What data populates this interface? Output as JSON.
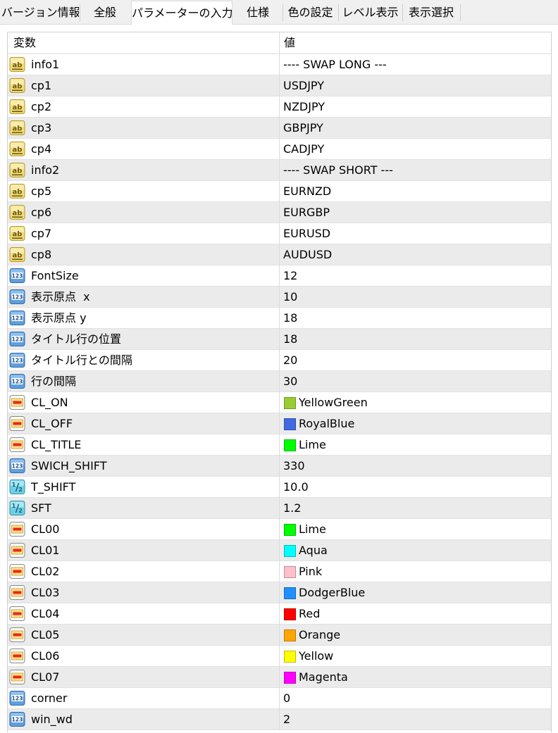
{
  "tabs": [
    "バージョン情報",
    "全般",
    "パラメーターの入力",
    "仕様",
    "色の設定",
    "レベル表示",
    "表示選択"
  ],
  "active_tab": "パラメーターの入力",
  "grid": {
    "col_variable": "変数",
    "col_value": "値",
    "rows": [
      {
        "icon": "string-type-icon",
        "name": "info1",
        "value": "---- SWAP LONG ---"
      },
      {
        "icon": "string-type-icon",
        "name": "cp1",
        "value": "USDJPY"
      },
      {
        "icon": "string-type-icon",
        "name": "cp2",
        "value": "NZDJPY"
      },
      {
        "icon": "string-type-icon",
        "name": "cp3",
        "value": "GBPJPY"
      },
      {
        "icon": "string-type-icon",
        "name": "cp4",
        "value": "CADJPY"
      },
      {
        "icon": "string-type-icon",
        "name": "info2",
        "value": "---- SWAP SHORT ---"
      },
      {
        "icon": "string-type-icon",
        "name": "cp5",
        "value": "EURNZD"
      },
      {
        "icon": "string-type-icon",
        "name": "cp6",
        "value": "EURGBP"
      },
      {
        "icon": "string-type-icon",
        "name": "cp7",
        "value": "EURUSD"
      },
      {
        "icon": "string-type-icon",
        "name": "cp8",
        "value": "AUDUSD"
      },
      {
        "icon": "integer-type-icon",
        "name": "FontSize",
        "value": "12"
      },
      {
        "icon": "integer-type-icon",
        "name": "表示原点  x",
        "value": "10"
      },
      {
        "icon": "integer-type-icon",
        "name": "表示原点 y",
        "value": "18"
      },
      {
        "icon": "integer-type-icon",
        "name": "タイトル行の位置",
        "value": "18"
      },
      {
        "icon": "integer-type-icon",
        "name": "タイトル行との間隔",
        "value": "20"
      },
      {
        "icon": "integer-type-icon",
        "name": "行の間隔",
        "value": "30"
      },
      {
        "icon": "color-type-icon",
        "name": "CL_ON",
        "value": "YellowGreen",
        "swatch": "#9acd32"
      },
      {
        "icon": "color-type-icon",
        "name": "CL_OFF",
        "value": "RoyalBlue",
        "swatch": "#4169e1"
      },
      {
        "icon": "color-type-icon",
        "name": "CL_TITLE",
        "value": "Lime",
        "swatch": "#00ff00"
      },
      {
        "icon": "integer-type-icon",
        "name": "SWICH_SHIFT",
        "value": "330"
      },
      {
        "icon": "double-type-icon",
        "name": "T_SHIFT",
        "value": "10.0"
      },
      {
        "icon": "double-type-icon",
        "name": "SFT",
        "value": "1.2"
      },
      {
        "icon": "color-type-icon",
        "name": "CL00",
        "value": "Lime",
        "swatch": "#00ff00"
      },
      {
        "icon": "color-type-icon",
        "name": "CL01",
        "value": "Aqua",
        "swatch": "#00ffff"
      },
      {
        "icon": "color-type-icon",
        "name": "CL02",
        "value": "Pink",
        "swatch": "#ffc0cb"
      },
      {
        "icon": "color-type-icon",
        "name": "CL03",
        "value": "DodgerBlue",
        "swatch": "#1e90ff"
      },
      {
        "icon": "color-type-icon",
        "name": "CL04",
        "value": "Red",
        "swatch": "#ff0000"
      },
      {
        "icon": "color-type-icon",
        "name": "CL05",
        "value": "Orange",
        "swatch": "#ffa500"
      },
      {
        "icon": "color-type-icon",
        "name": "CL06",
        "value": "Yellow",
        "swatch": "#ffff00"
      },
      {
        "icon": "color-type-icon",
        "name": "CL07",
        "value": "Magenta",
        "swatch": "#ff00ff"
      },
      {
        "icon": "integer-type-icon",
        "name": "corner",
        "value": "0"
      },
      {
        "icon": "integer-type-icon",
        "name": "win_wd",
        "value": "2"
      }
    ]
  }
}
